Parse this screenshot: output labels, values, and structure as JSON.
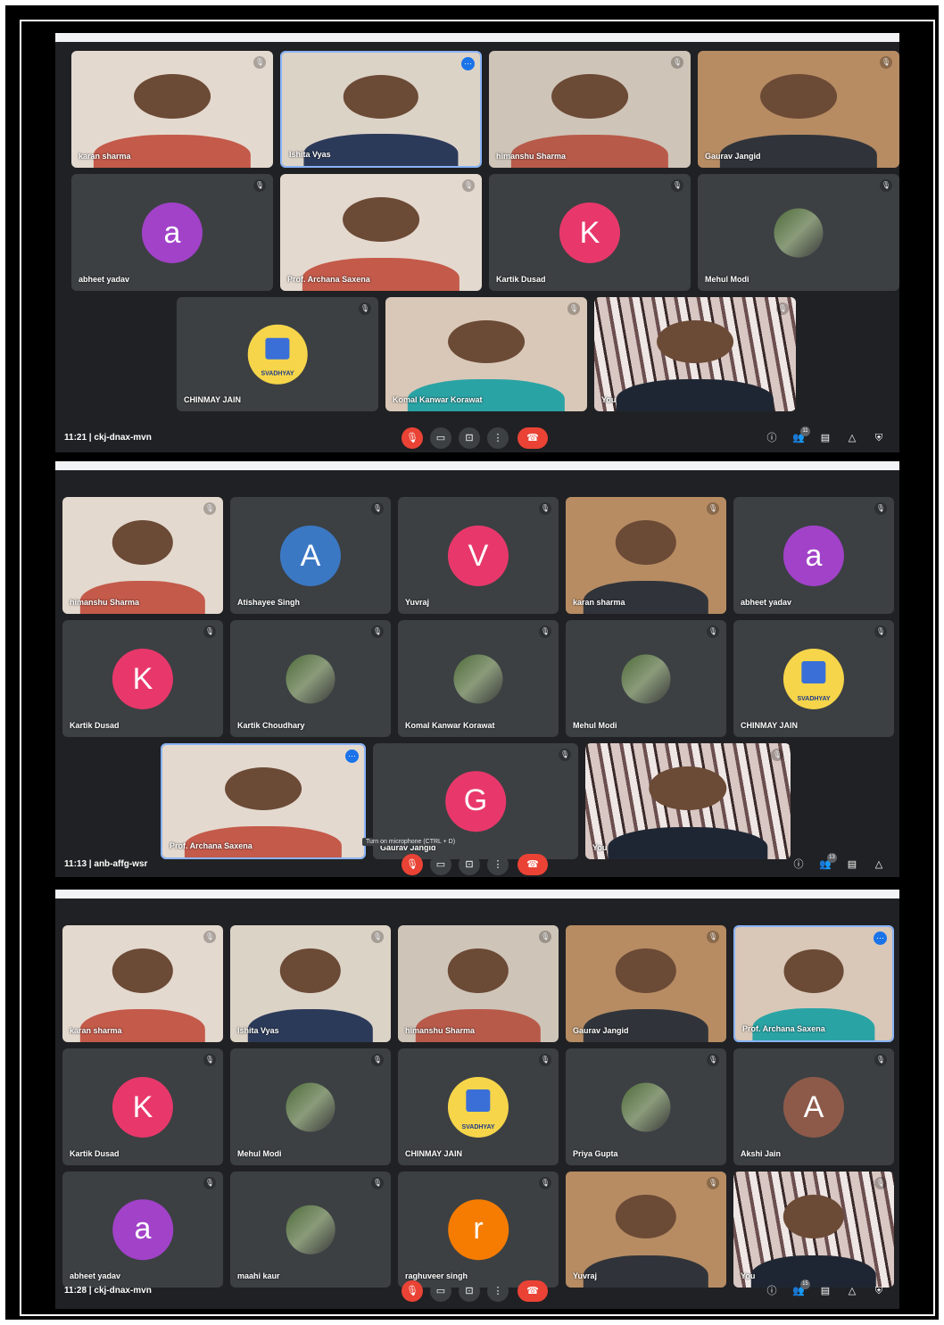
{
  "colors": {
    "background": "#202124",
    "tile": "#3c4043",
    "active_border": "#8ab4f8",
    "end_call": "#ea4335"
  },
  "icons": {
    "mic_off": "mic-off-icon",
    "more": "more-options-icon",
    "info": "info-icon",
    "people": "people-icon",
    "chat": "chat-icon",
    "activities": "activities-icon",
    "lock": "host-controls-icon"
  },
  "screens": [
    {
      "time": "11:21",
      "meeting_code": "ckj-dnax-mvn",
      "participants_count": "11",
      "tiles": [
        {
          "name": "karan sharma",
          "type": "photo"
        },
        {
          "name": "Ishita Vyas",
          "type": "photo",
          "active": true
        },
        {
          "name": "himanshu Sharma",
          "type": "photo"
        },
        {
          "name": "Gaurav Jangid",
          "type": "photo"
        },
        {
          "name": "abheet yadav",
          "type": "avatar",
          "letter": "a",
          "color": "#a142c8"
        },
        {
          "name": "Prof. Archana Saxena",
          "type": "photo"
        },
        {
          "name": "Kartik Dusad",
          "type": "avatar",
          "letter": "K",
          "color": "#e8386b"
        },
        {
          "name": "Mehul Modi",
          "type": "picture"
        },
        {
          "name": "CHINMAY JAIN",
          "type": "logo",
          "logo_text": "SVADHYAY"
        },
        {
          "name": "Komal Kanwar Korawat",
          "type": "photo"
        },
        {
          "name": "You",
          "type": "self"
        }
      ]
    },
    {
      "time": "11:13",
      "meeting_code": "anb-affg-wsr",
      "participants_count": "13",
      "tooltip": "Turn on microphone (CTRL + D)",
      "tiles": [
        {
          "name": "himanshu Sharma",
          "type": "photo"
        },
        {
          "name": "Atishayee Singh",
          "type": "avatar",
          "letter": "A",
          "color": "#3b78c4"
        },
        {
          "name": "Yuvraj",
          "type": "avatar",
          "letter": "V",
          "color": "#e8386b"
        },
        {
          "name": "karan sharma",
          "type": "photo"
        },
        {
          "name": "abheet yadav",
          "type": "avatar",
          "letter": "a",
          "color": "#a142c8"
        },
        {
          "name": "Kartik Dusad",
          "type": "avatar",
          "letter": "K",
          "color": "#e8386b"
        },
        {
          "name": "Kartik Choudhary",
          "type": "picture"
        },
        {
          "name": "Komal Kanwar Korawat",
          "type": "picture"
        },
        {
          "name": "Mehul Modi",
          "type": "picture"
        },
        {
          "name": "CHINMAY JAIN",
          "type": "logo",
          "logo_text": "SVADHYAY"
        },
        {
          "name": "Prof. Archana Saxena",
          "type": "photo",
          "active": true
        },
        {
          "name": "Gaurav Jangid",
          "type": "avatar",
          "letter": "G",
          "color": "#e8386b"
        },
        {
          "name": "You",
          "type": "self"
        }
      ]
    },
    {
      "time": "11:28",
      "meeting_code": "ckj-dnax-mvn",
      "participants_count": "15",
      "tiles": [
        {
          "name": "karan sharma",
          "type": "photo"
        },
        {
          "name": "Ishita Vyas",
          "type": "photo"
        },
        {
          "name": "himanshu Sharma",
          "type": "photo"
        },
        {
          "name": "Gaurav Jangid",
          "type": "photo"
        },
        {
          "name": "Prof. Archana Saxena",
          "type": "photo",
          "active": true
        },
        {
          "name": "Kartik Dusad",
          "type": "avatar",
          "letter": "K",
          "color": "#e8386b"
        },
        {
          "name": "Mehul Modi",
          "type": "picture"
        },
        {
          "name": "CHINMAY JAIN",
          "type": "logo",
          "logo_text": "SVADHYAY"
        },
        {
          "name": "Priya Gupta",
          "type": "picture"
        },
        {
          "name": "Akshi Jain",
          "type": "avatar",
          "letter": "A",
          "color": "#8d5a4a"
        },
        {
          "name": "abheet yadav",
          "type": "avatar",
          "letter": "a",
          "color": "#a142c8"
        },
        {
          "name": "maahi kaur",
          "type": "picture"
        },
        {
          "name": "raghuveer singh",
          "type": "avatar",
          "letter": "r",
          "color": "#f57c00"
        },
        {
          "name": "Yuvraj",
          "type": "photo"
        },
        {
          "name": "You",
          "type": "self"
        }
      ]
    }
  ]
}
